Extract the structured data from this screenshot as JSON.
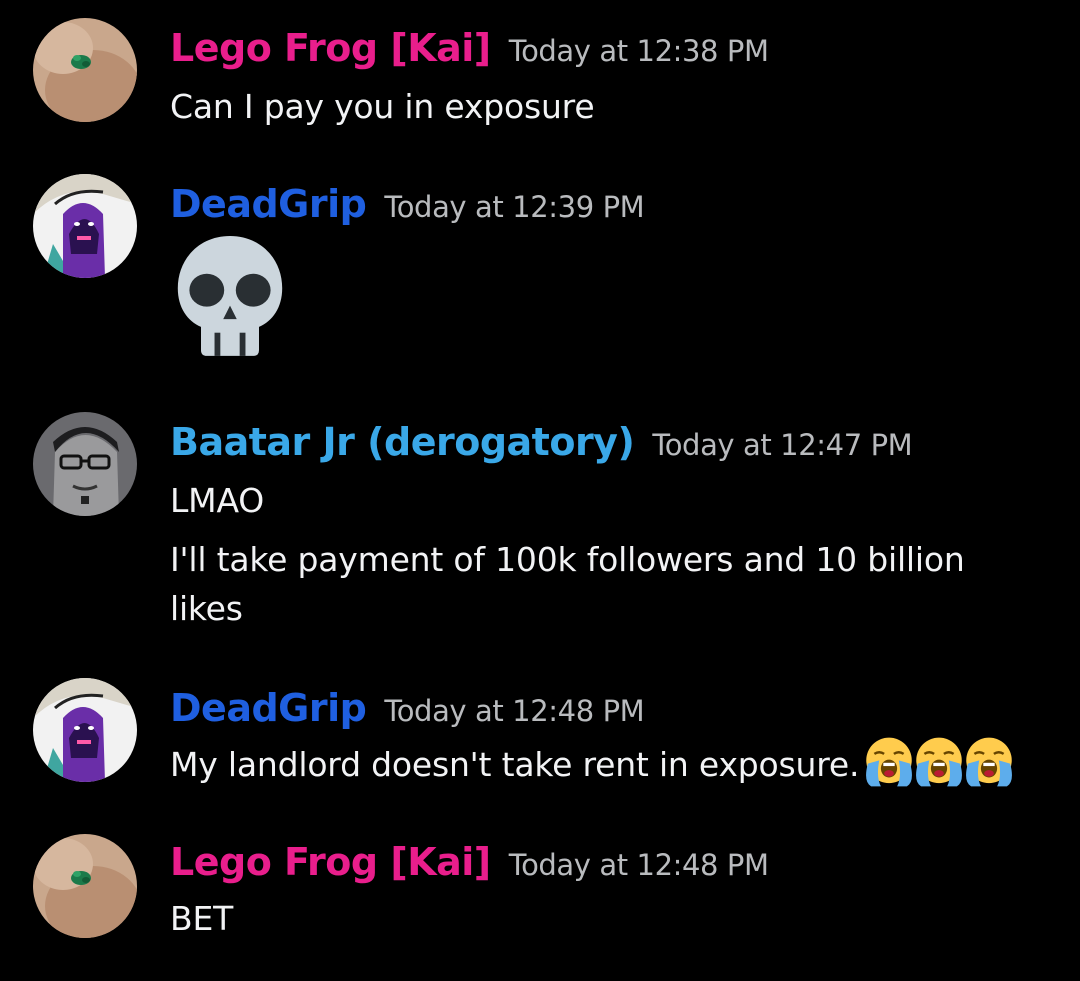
{
  "colors": {
    "background": "#000000",
    "lego_frog": "#e91e8c",
    "deadgrip": "#1f5fe0",
    "baatar": "#3aa8e8",
    "timestamp": "#b9bbbe",
    "message_text": "#f2f3f5"
  },
  "messages": [
    {
      "author": "Lego Frog [Kai]",
      "timestamp": "Today at 12:38 PM",
      "lines": [
        "Can I pay you in exposure"
      ],
      "avatar_icon": "lego-frog-avatar"
    },
    {
      "author": "DeadGrip",
      "timestamp": "Today at 12:39 PM",
      "emoji": "skull-emoji",
      "avatar_icon": "deadgrip-avatar"
    },
    {
      "author": "Baatar Jr (derogatory)",
      "timestamp": "Today at 12:47 PM",
      "lines": [
        "LMAO",
        "I'll take payment of 100k followers and 10 billion",
        "likes"
      ],
      "avatar_icon": "baatar-avatar"
    },
    {
      "author": "DeadGrip",
      "timestamp": "Today at 12:48 PM",
      "lines": [
        "My landlord doesn't take rent in exposure."
      ],
      "trailing_emoji": [
        "loudly-crying-emoji",
        "loudly-crying-emoji",
        "loudly-crying-emoji"
      ],
      "avatar_icon": "deadgrip-avatar"
    },
    {
      "author": "Lego Frog [Kai]",
      "timestamp": "Today at 12:48 PM",
      "lines": [
        "BET"
      ],
      "avatar_icon": "lego-frog-avatar"
    }
  ]
}
